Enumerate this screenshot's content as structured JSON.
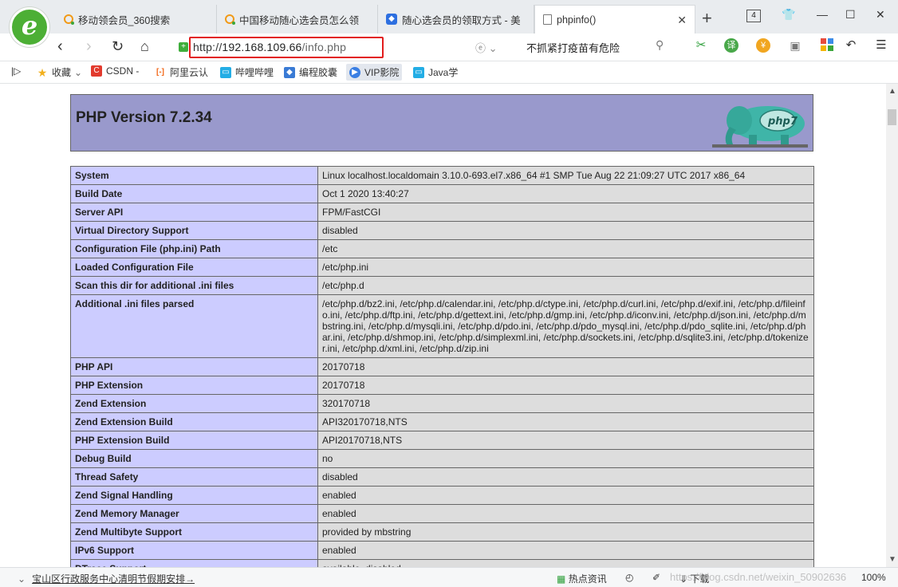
{
  "tabs": [
    {
      "title": "移动领会员_360搜索",
      "icon": "360-search-icon"
    },
    {
      "title": "中国移动随心选会员怎么领",
      "icon": "360-search-icon"
    },
    {
      "title": "随心选会员的领取方式 - 美",
      "icon": "blue-app-icon"
    },
    {
      "title": "phpinfo()",
      "icon": "page-icon",
      "active": true
    }
  ],
  "tab_count_badge": "4",
  "address": {
    "scheme": "http://",
    "host": "192.168.109.66",
    "path": "/info.php"
  },
  "search_box": {
    "text": "不抓紧打疫苗有危险"
  },
  "bookmarks": [
    {
      "label": "收藏",
      "icon": "star-icon"
    },
    {
      "label": "CSDN -",
      "icon": "csdn-icon"
    },
    {
      "label": "阿里云认",
      "icon": "aliyun-icon"
    },
    {
      "label": "哔哩哔哩",
      "icon": "bilibili-icon"
    },
    {
      "label": "编程胶囊",
      "icon": "capsule-icon"
    },
    {
      "label": "VIP影院",
      "icon": "play-icon"
    },
    {
      "label": "Java学",
      "icon": "bilibili-icon"
    }
  ],
  "php": {
    "title": "PHP Version 7.2.34",
    "logo_text": "php7",
    "rows": [
      {
        "key": "System",
        "value": "Linux localhost.localdomain 3.10.0-693.el7.x86_64 #1 SMP Tue Aug 22 21:09:27 UTC 2017 x86_64"
      },
      {
        "key": "Build Date",
        "value": "Oct 1 2020 13:40:27"
      },
      {
        "key": "Server API",
        "value": "FPM/FastCGI"
      },
      {
        "key": "Virtual Directory Support",
        "value": "disabled"
      },
      {
        "key": "Configuration File (php.ini) Path",
        "value": "/etc"
      },
      {
        "key": "Loaded Configuration File",
        "value": "/etc/php.ini"
      },
      {
        "key": "Scan this dir for additional .ini files",
        "value": "/etc/php.d"
      },
      {
        "key": "Additional .ini files parsed",
        "value": "/etc/php.d/bz2.ini, /etc/php.d/calendar.ini, /etc/php.d/ctype.ini, /etc/php.d/curl.ini, /etc/php.d/exif.ini, /etc/php.d/fileinfo.ini, /etc/php.d/ftp.ini, /etc/php.d/gettext.ini, /etc/php.d/gmp.ini, /etc/php.d/iconv.ini, /etc/php.d/json.ini, /etc/php.d/mbstring.ini, /etc/php.d/mysqli.ini, /etc/php.d/pdo.ini, /etc/php.d/pdo_mysql.ini, /etc/php.d/pdo_sqlite.ini, /etc/php.d/phar.ini, /etc/php.d/shmop.ini, /etc/php.d/simplexml.ini, /etc/php.d/sockets.ini, /etc/php.d/sqlite3.ini, /etc/php.d/tokenizer.ini, /etc/php.d/xml.ini, /etc/php.d/zip.ini"
      },
      {
        "key": "PHP API",
        "value": "20170718"
      },
      {
        "key": "PHP Extension",
        "value": "20170718"
      },
      {
        "key": "Zend Extension",
        "value": "320170718"
      },
      {
        "key": "Zend Extension Build",
        "value": "API320170718,NTS"
      },
      {
        "key": "PHP Extension Build",
        "value": "API20170718,NTS"
      },
      {
        "key": "Debug Build",
        "value": "no"
      },
      {
        "key": "Thread Safety",
        "value": "disabled"
      },
      {
        "key": "Zend Signal Handling",
        "value": "enabled"
      },
      {
        "key": "Zend Memory Manager",
        "value": "enabled"
      },
      {
        "key": "Zend Multibyte Support",
        "value": "provided by mbstring"
      },
      {
        "key": "IPv6 Support",
        "value": "enabled"
      },
      {
        "key": "DTrace Support",
        "value": "available, disabled"
      }
    ]
  },
  "status": {
    "news_link": "宝山区行政服务中心清明节假期安排→",
    "hot_news": "热点资讯",
    "download": "下载",
    "watermark": "https://blog.csdn.net/weixin_50902636",
    "zoom": "100%"
  },
  "colors": {
    "header_bg": "#9999cc",
    "key_bg": "#ccccff",
    "value_bg": "#dddddd",
    "highlight": "#e21c1c"
  }
}
